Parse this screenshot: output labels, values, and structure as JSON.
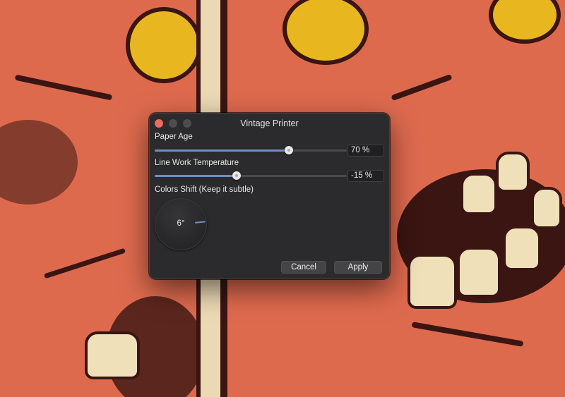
{
  "window": {
    "title": "Vintage Printer"
  },
  "controls": {
    "paper_age": {
      "label": "Paper Age",
      "value": 70,
      "value_text": "70 %",
      "min": 0,
      "max": 100
    },
    "line_work_temperature": {
      "label": "Line Work Temperature",
      "value": -15,
      "value_text": "-15 %",
      "min": -100,
      "max": 100
    },
    "colors_shift": {
      "label": "Colors Shift (Keep it subtle)",
      "value": 6,
      "value_text": "6°"
    }
  },
  "buttons": {
    "cancel_label": "Cancel",
    "apply_label": "Apply"
  },
  "colors": {
    "accent": "#6e8fc2",
    "close_button": "#ed6a5e",
    "dialog_background": "#2b2b2d"
  }
}
